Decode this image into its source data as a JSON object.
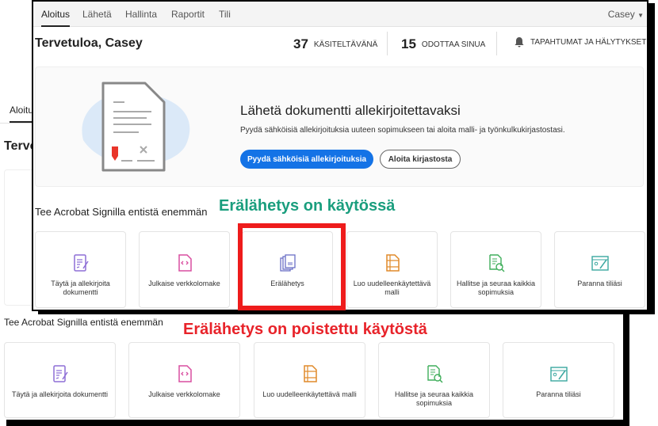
{
  "nav": {
    "items": [
      "Aloitus",
      "Lähetä",
      "Hallinta",
      "Raportit",
      "Tili"
    ],
    "user": "Casey"
  },
  "header": {
    "title": "Tervetuloa, Casey",
    "stats": [
      {
        "count": "37",
        "label": "KÄSITELTÄVÄNÄ"
      },
      {
        "count": "15",
        "label": "ODOTTAA SINUA"
      }
    ],
    "alerts": "TAPAHTUMAT JA HÄLYTYKSET"
  },
  "hero": {
    "heading": "Lähetä dokumentti allekirjoitettavaksi",
    "text": "Pyydä sähköisiä allekirjoituksia uuteen sopimukseen tai aloita malli- ja työnkulkukirjastostasi.",
    "primary": "Pyydä sähköisiä allekirjoituksia",
    "secondary": "Aloita kirjastosta"
  },
  "section": "Tee Acrobat Signilla entistä enemmän",
  "enabled_tiles": [
    "Täytä ja allekirjoita dokumentti",
    "Julkaise verkkolomake",
    "Erälähetys",
    "Luo uudelleenkäytettävä malli",
    "Hallitse ja seuraa kaikkia sopimuksia",
    "Paranna tiliäsi"
  ],
  "disabled_tiles": [
    "Täytä ja allekirjoita dokumentti",
    "Julkaise verkkolomake",
    "Luo uudelleenkäytettävä malli",
    "Hallitse ja seuraa kaikkia sopimuksia",
    "Paranna tiliäsi"
  ],
  "back": {
    "nav_item": "Aloitus",
    "title": "Tervetuloa, Casey"
  },
  "annotations": {
    "enabled": "Erälähetys on käytössä",
    "disabled": "Erälähetys on poistettu käytöstä"
  },
  "colors": {
    "enabled": "#1a9e7e",
    "disabled": "#e8232a",
    "highlight": "#ee1c1c",
    "primary": "#1473e6"
  }
}
